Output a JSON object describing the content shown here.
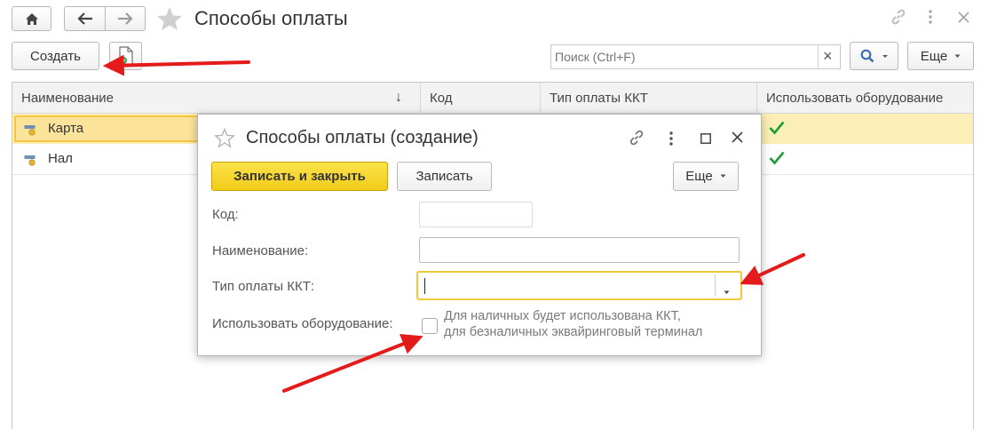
{
  "window": {
    "title": "Способы оплаты"
  },
  "toolbar": {
    "create_label": "Создать",
    "search_placeholder": "Поиск (Ctrl+F)",
    "search_clear": "×",
    "more_label": "Еще"
  },
  "table": {
    "columns": [
      "Наименование",
      "Код",
      "Тип оплаты ККТ",
      "Использовать оборудование"
    ],
    "sort_indicator": "↓",
    "rows": [
      {
        "name": "Карта",
        "uses_equipment": true,
        "selected": true
      },
      {
        "name": "Нал",
        "uses_equipment": true,
        "selected": false
      }
    ]
  },
  "dialog": {
    "title": "Способы оплаты (создание)",
    "save_close_label": "Записать и закрыть",
    "save_label": "Записать",
    "more_label": "Еще",
    "fields": {
      "code_label": "Код:",
      "code_value": "",
      "name_label": "Наименование:",
      "name_value": "",
      "kkt_type_label": "Тип оплаты ККТ:",
      "kkt_type_value": "",
      "equipment_label": "Использовать оборудование:",
      "equipment_checked": false,
      "equipment_hint_line1": "Для наличных будет использована ККТ,",
      "equipment_hint_line2": "для безналичных эквайринговый терминал"
    }
  },
  "colors": {
    "accent_yellow": "#f5d534",
    "selected_row": "#fbeeb6",
    "annotation_arrow": "#e31b1b",
    "check_green": "#1a9e3a",
    "search_blue": "#3a6fb0"
  }
}
